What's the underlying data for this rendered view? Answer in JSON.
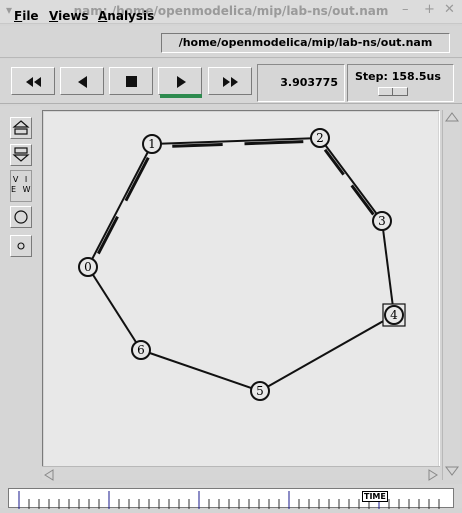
{
  "window": {
    "title": "nam: /home/openmodelica/mip/lab-ns/out.nam",
    "menu_glyph": "▾",
    "controls": [
      "–",
      "+",
      "✕"
    ]
  },
  "menu": {
    "items": [
      {
        "key": "F",
        "rest": "ile"
      },
      {
        "key": "V",
        "rest": "iews"
      },
      {
        "key": "A",
        "rest": "nalysis"
      }
    ],
    "path": "/home/openmodelica/mip/lab-ns/out.nam"
  },
  "controls": {
    "buttons": [
      "rewind-icon",
      "play-backward-icon",
      "stop-icon",
      "play-forward-icon",
      "fast-forward-icon"
    ],
    "active": "play-forward-icon",
    "time": "3.903775",
    "step_label": "Step: 158.5us"
  },
  "toolbar": {
    "view_text": "V I\nE W",
    "icons": [
      "zoom-in-icon",
      "zoom-out-icon",
      "large-circle-icon",
      "small-circle-icon"
    ]
  },
  "network": {
    "nodes": [
      {
        "id": "0",
        "shape": "circle"
      },
      {
        "id": "1",
        "shape": "circle"
      },
      {
        "id": "2",
        "shape": "circle"
      },
      {
        "id": "3",
        "shape": "circle"
      },
      {
        "id": "4",
        "shape": "square"
      },
      {
        "id": "5",
        "shape": "circle"
      },
      {
        "id": "6",
        "shape": "circle"
      }
    ],
    "links": [
      {
        "from": "0",
        "to": "1",
        "has_packets": true
      },
      {
        "from": "1",
        "to": "2",
        "has_packets": true
      },
      {
        "from": "2",
        "to": "3",
        "has_packets": true
      },
      {
        "from": "3",
        "to": "4",
        "has_packets": false
      },
      {
        "from": "4",
        "to": "5",
        "has_packets": false
      },
      {
        "from": "5",
        "to": "6",
        "has_packets": false
      },
      {
        "from": "6",
        "to": "0",
        "has_packets": false
      }
    ]
  },
  "timeline": {
    "label": "TIME"
  },
  "colors": {
    "play_indicator": "#2d8a4e",
    "canvas_bg": "#e8e8e8",
    "timeline_marks": "#1a1a8c"
  }
}
